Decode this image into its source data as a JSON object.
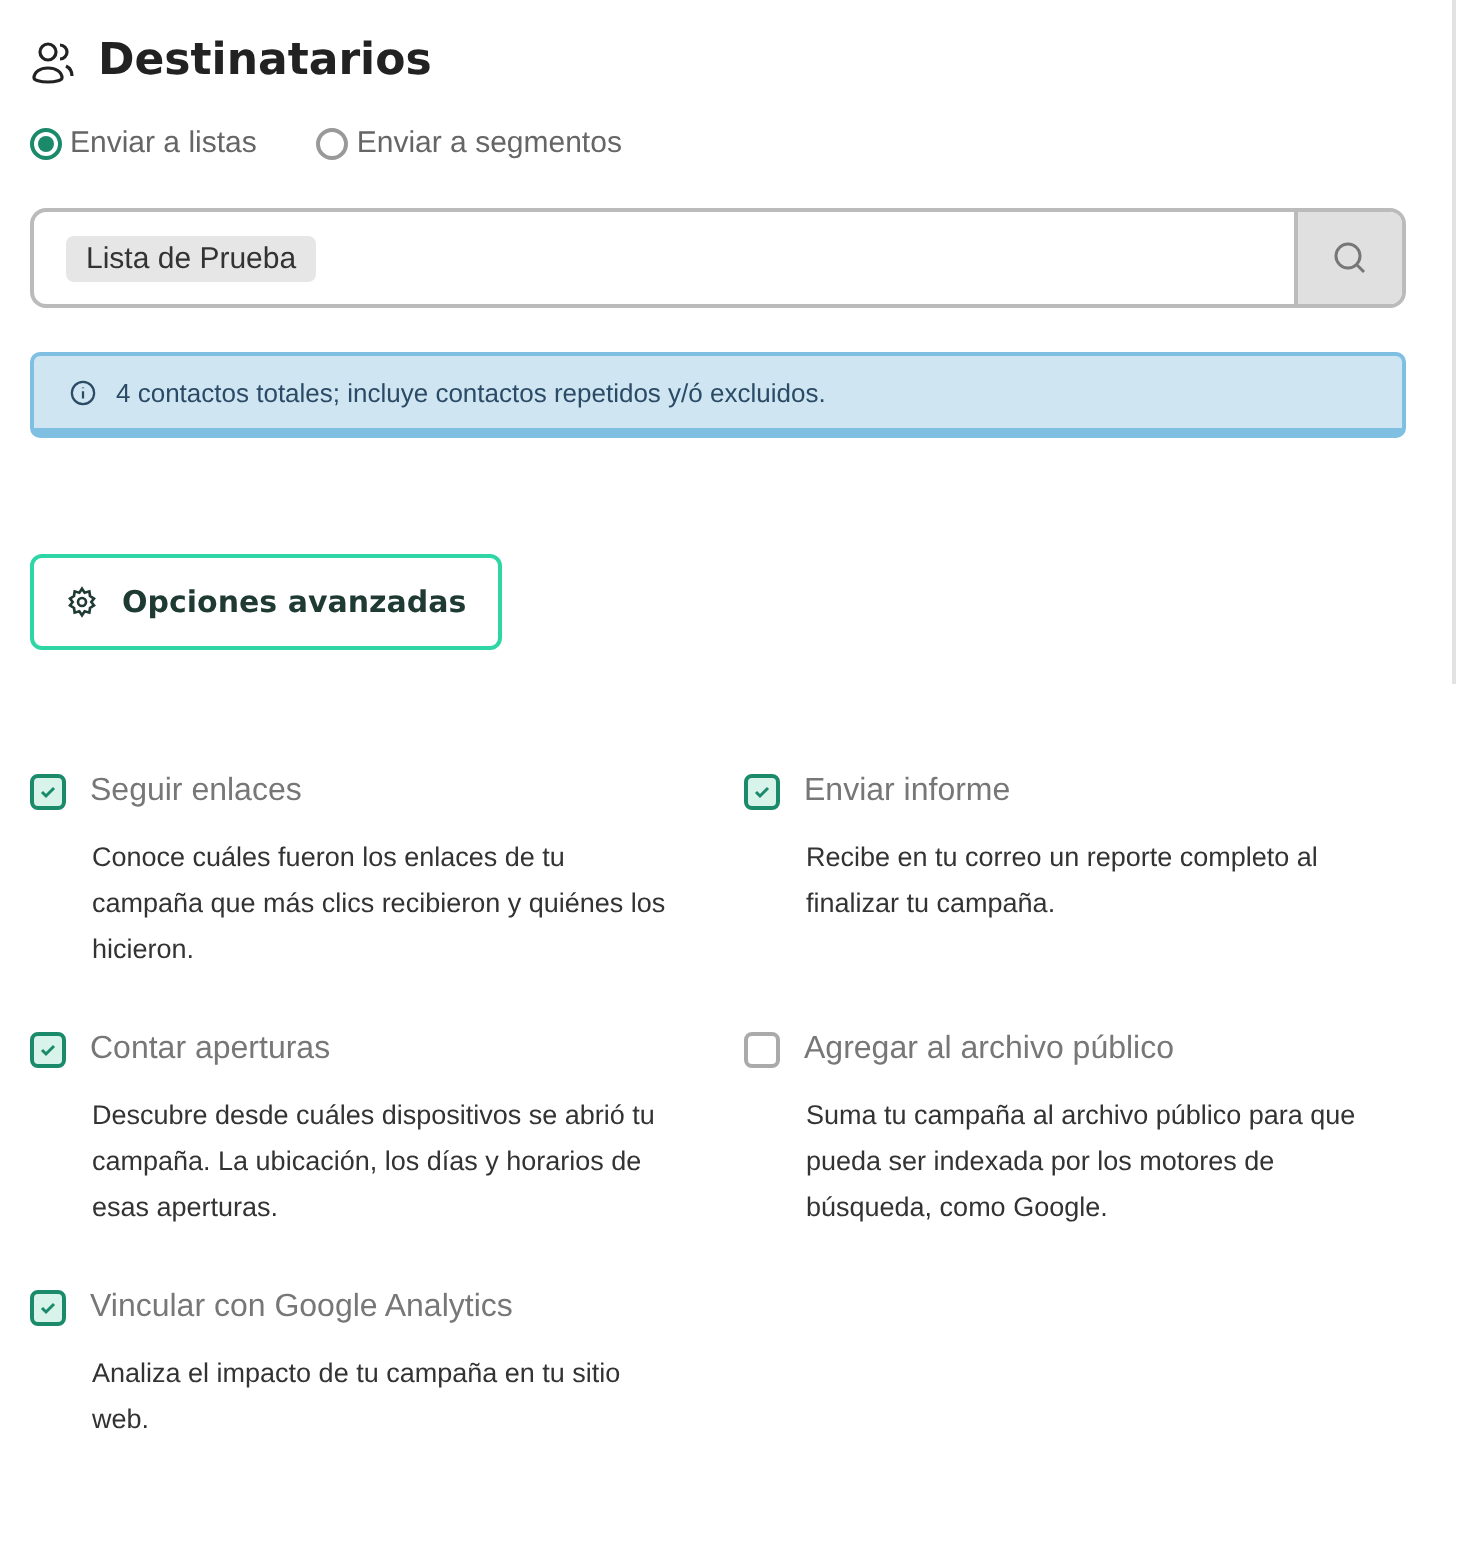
{
  "section": {
    "title": "Destinatarios"
  },
  "send_mode": [
    {
      "label": "Enviar a listas",
      "selected": true
    },
    {
      "label": "Enviar a segmentos",
      "selected": false
    }
  ],
  "list_field": {
    "tags": [
      "Lista de Prueba"
    ]
  },
  "info_alert": {
    "text": "4 contactos totales; incluye contactos repetidos y/ó excluidos."
  },
  "advanced_button": {
    "label": "Opciones avanzadas"
  },
  "options": [
    {
      "label": "Seguir enlaces",
      "checked": true,
      "description": "Conoce cuáles fueron los enlaces de tu campaña que más clics recibieron y quiénes los hicieron."
    },
    {
      "label": "Enviar informe",
      "checked": true,
      "description": "Recibe en tu correo un reporte completo al finalizar tu campaña."
    },
    {
      "label": "Contar aperturas",
      "checked": true,
      "description": "Descubre desde cuáles dispositivos se abrió tu campaña. La ubicación, los días y horarios de esas aperturas."
    },
    {
      "label": "Agregar al archivo público",
      "checked": false,
      "description": "Suma tu campaña al archivo público para que pueda ser indexada por los motores de búsqueda, como Google."
    },
    {
      "label": "Vincular con Google Analytics",
      "checked": true,
      "description": "Analiza el impacto de tu campaña en tu sitio web."
    }
  ]
}
